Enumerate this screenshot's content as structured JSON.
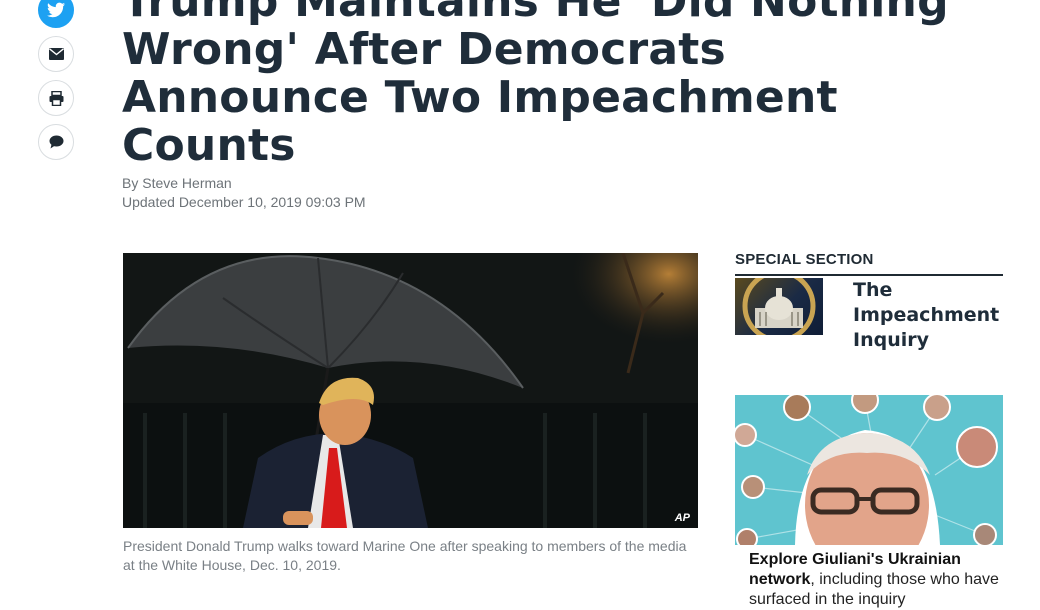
{
  "share": {
    "items": [
      {
        "name": "twitter"
      },
      {
        "name": "email"
      },
      {
        "name": "print"
      },
      {
        "name": "comment"
      }
    ],
    "twitter_color": "#1da1f2"
  },
  "article": {
    "headline_lines": [
      "Trump Maintains He 'Did Nothing",
      "Wrong' After Democrats",
      "Announce Two Impeachment",
      "Counts"
    ],
    "byline": "By Steve Herman",
    "updated": "Updated December 10, 2019 09:03 PM",
    "photo_credit": "AP",
    "caption": "President Donald Trump walks toward Marine One after speaking to members of the media at the White House, Dec. 10, 2019."
  },
  "sidebar": {
    "section_label": "SPECIAL SECTION",
    "special_title": "The Impeachment Inquiry",
    "promo_bold": "Explore Giuliani's Ukrainian network",
    "promo_rest": ", including those who have surfaced in the inquiry"
  }
}
